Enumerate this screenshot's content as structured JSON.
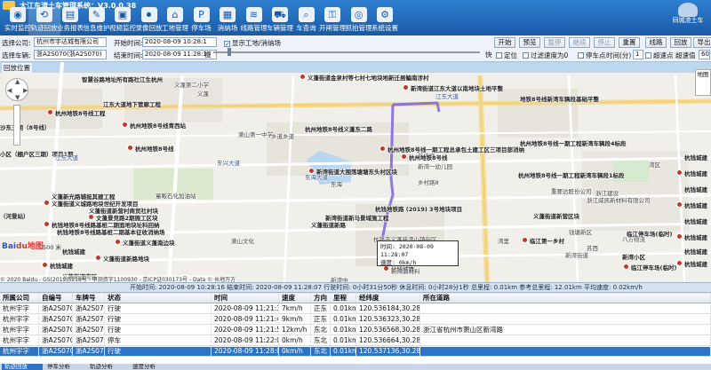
{
  "app": {
    "title": "大江东渣土车管理系统：V3.0.0.38"
  },
  "toolbar": {
    "items": [
      {
        "label": "实时监控",
        "icon": "monitor-icon"
      },
      {
        "label": "轨迹回放",
        "icon": "track-playback-icon"
      },
      {
        "label": "业务报表",
        "icon": "report-icon"
      },
      {
        "label": "信息维护",
        "icon": "info-maintenance-icon"
      },
      {
        "label": "视频监控",
        "icon": "video-icon"
      },
      {
        "label": "录像回放",
        "icon": "recording-icon"
      },
      {
        "label": "工地管理",
        "icon": "site-icon"
      },
      {
        "label": "停车场",
        "icon": "parking-icon"
      },
      {
        "label": "消纳场",
        "icon": "disposal-icon"
      },
      {
        "label": "线路管理",
        "icon": "route-icon"
      },
      {
        "label": "车辆管理",
        "icon": "vehicle-icon"
      },
      {
        "label": "车查询",
        "icon": "vehicle-query-icon"
      },
      {
        "label": "开闸管理",
        "icon": "gate-icon"
      },
      {
        "label": "抓拍管理",
        "icon": "snapshot-icon"
      },
      {
        "label": "系统设置",
        "icon": "settings-icon"
      }
    ],
    "corner_logo": "同城渣土车"
  },
  "controls": {
    "company_label": "选择公司:",
    "company_value": "杭州市宇达城有限公司",
    "vehicle_label": "选择车辆:",
    "vehicle_value": "浙A2S070(浙A2S070)",
    "start_label": "开始时间:",
    "start_value": "2020-08-09 10:28:1",
    "end_label": "结束时间:",
    "end_value": "2020-08-09 11:28:1",
    "show_sites": "显示工地/消纳场",
    "slow_label": "慢",
    "fast_label": "快",
    "locate_label": "定位",
    "parking_label": "停车点",
    "filter_speed_label": "过滤速度为0",
    "stop_time_label": "停车点",
    "time_unit_label": "时间(分)",
    "stop_time_value": "1",
    "overspeed_label": "超速点",
    "overspeed_limit_label": "超速值",
    "overspeed_value": "60",
    "track_return_label": "回放位置",
    "buttons": [
      "开始",
      "预览",
      "暂停",
      "继续",
      "停止",
      "重置",
      "线路",
      "回放",
      "导出"
    ]
  },
  "map": {
    "pois": [
      {
        "t": "义蓬街道金泉村等七村七地块地新迁居鳊南涉村",
        "s": "poi"
      },
      {
        "t": "智慧谷路地址所有路社江生杭州",
        "s": "poi"
      },
      {
        "t": "新湾街道江东大道以南地块土地平整",
        "s": "poi"
      },
      {
        "t": "江东大道地下管廊工程",
        "s": "poi"
      },
      {
        "t": "杭州地铁8号线工程",
        "s": "poi"
      },
      {
        "t": "地铁8号线新湾车辆段基础平整",
        "s": "poi"
      },
      {
        "t": "杭州地铁8号线青西站",
        "s": "poi"
      },
      {
        "t": "杭州地铁8号线义蓬东二路",
        "s": "poi"
      },
      {
        "t": "江东大道",
        "s": "blue"
      },
      {
        "t": "义蓬第二小学",
        "s": "plain"
      },
      {
        "t": "杭州地铁8号线一期工程总承包土建工区三项目部消纳",
        "s": "poi"
      },
      {
        "t": "杭州地铁8号线一期工程新湾车辆段4标段",
        "s": "poi"
      },
      {
        "t": "新湾街道大围荡塘塘东头村区块",
        "s": "poi"
      },
      {
        "t": "杭州地铁8号线一期工程新湾车辆段1标段",
        "s": "poi"
      },
      {
        "t": "重要达股份公司",
        "s": "plain"
      },
      {
        "t": "杭钱城建",
        "s": "poi"
      },
      {
        "t": "杭钱城建",
        "s": "poi"
      },
      {
        "t": "东海大道",
        "s": "blue"
      },
      {
        "t": "童畈石化加油站",
        "s": "plain"
      },
      {
        "t": "义蓬新光路辅挺其建工程",
        "s": "poi"
      },
      {
        "t": "义蓬街道义城路地块世纪开发项目",
        "s": "poi"
      },
      {
        "t": "杭钱城建",
        "s": "poi"
      },
      {
        "t": "杭钱城建",
        "s": "poi"
      },
      {
        "t": "义蓬街道新营村商贸社村块",
        "s": "poi"
      },
      {
        "t": "文蓬景竞路2期施工区块",
        "s": "poi"
      },
      {
        "t": "杭钱城建",
        "s": "poi"
      },
      {
        "t": "杭钱地铁8号线路基桩二期面地块址科回纳",
        "s": "poi"
      },
      {
        "t": "杭钱地铁8号线路基桩二期基本征收消纳场",
        "s": "poi"
      },
      {
        "t": "义蓬街道义蓬南边块",
        "s": "poi"
      },
      {
        "t": "新湾街道新马景域施工程",
        "s": "poi"
      },
      {
        "t": "杭钱城建",
        "s": "poi"
      },
      {
        "t": "杭钱城建",
        "s": "poi"
      },
      {
        "t": "杭钱城建",
        "s": "poi"
      },
      {
        "t": "义蓬街道新路",
        "s": "poi"
      },
      {
        "t": "义蓬街道新路地块",
        "s": "poi"
      },
      {
        "t": "杭钱城建",
        "s": "poi"
      },
      {
        "t": "杭钱城建",
        "s": "poi"
      },
      {
        "t": "杭钱城建",
        "s": "poi"
      },
      {
        "t": "杭钱城建",
        "s": "poi"
      },
      {
        "t": "义蓬街道新营区块",
        "s": "poi"
      },
      {
        "t": "临江第一乡村",
        "s": "poi"
      },
      {
        "t": "义蓬街道南区",
        "s": "poi"
      },
      {
        "t": "杭钱城建",
        "s": "poi"
      },
      {
        "t": "新湾小区",
        "s": "poi"
      },
      {
        "t": "临江停车场(临时)",
        "s": "poi"
      },
      {
        "t": "乡道乡道",
        "s": "plain"
      },
      {
        "t": "新湾一幼儿园",
        "s": "plain"
      },
      {
        "t": "新湾路",
        "s": "plain"
      },
      {
        "t": "浙江威凯新材料有限公司",
        "s": "plain"
      },
      {
        "t": "浙江建设",
        "s": "plain"
      },
      {
        "t": "八方物流",
        "s": "plain"
      },
      {
        "t": "苏西",
        "s": "plain"
      },
      {
        "t": "新湾街道",
        "s": "plain"
      },
      {
        "t": "钱塘新区",
        "s": "plain"
      },
      {
        "t": "新湾鼎材料",
        "s": "plain"
      },
      {
        "t": "东兴大道",
        "s": "blue"
      },
      {
        "t": "新湾中",
        "s": "plain"
      },
      {
        "t": "湾区",
        "s": "plain"
      },
      {
        "t": "东海",
        "s": "plain"
      },
      {
        "t": "萧山文化",
        "s": "plain"
      },
      {
        "t": "义蓬",
        "s": "plain"
      },
      {
        "t": "沙东三期（8号线）",
        "s": "poi"
      },
      {
        "t": "小区（棚户区三期）项目1期",
        "s": "poi"
      },
      {
        "t": "（河景站）",
        "s": "poi"
      },
      {
        "t": "萧山第一中学",
        "s": "plain"
      },
      {
        "t": "乡村路8",
        "s": "plain"
      },
      {
        "t": "杭州地铁8号线",
        "s": "poi"
      },
      {
        "t": "江东大道",
        "s": "blue"
      },
      {
        "t": "杭州地铁8号线",
        "s": "poi"
      },
      {
        "t": "杭钱地铁路 (2019) 3号地块项目",
        "s": "poi"
      },
      {
        "t": "杭钱市义蓬新湾小镇街区",
        "s": "plain"
      },
      {
        "t": "湾里",
        "s": "plain"
      },
      {
        "t": "新湾街道",
        "s": "plain"
      },
      {
        "t": "临江停车场(临时)",
        "s": "poi"
      }
    ],
    "tooltip_time": "时间: 2020-08-09 11:28:07",
    "tooltip_speed": "速度: 0km/h",
    "baidu_label_1": "Bai",
    "baidu_label_2": "du地图",
    "scale_label": "500 米",
    "copyright": "© 2020 Baidu - GS(2019)5218号 - 甲测资字1100930 - 京ICP证030173号 - Data © 长地万方",
    "maptype_label": "地图"
  },
  "summary": "开始时间: 2020-08-09 10:28:16  结束时间: 2020-08-09 11:28:07  行驶时间: 0小时31分50秒  休息时间: 0小时28分1秒  总里程: 0.01km  参考总里程: 12.01km  平均速度: 0.02km/h",
  "table": {
    "columns": [
      "所属公司",
      "自编号",
      "车牌号",
      "状态",
      "时间",
      "速度",
      "方向",
      "里程",
      "经纬度",
      "所在道路"
    ],
    "rows": [
      [
        "杭州宇字",
        "浙A2S070",
        "浙A2S07",
        "行驶",
        "2020-08-09 11:21:37",
        "7km/h",
        "正东",
        "0.01km",
        "120.536184,30.288",
        ""
      ],
      [
        "杭州宇字",
        "浙A2S070",
        "浙A2S07",
        "行驶",
        "2020-08-09 11:21:47",
        "9km/h",
        "正东",
        "0.01km",
        "120.536323,30.288",
        ""
      ],
      [
        "杭州宇字",
        "浙A2S070",
        "浙A2S07",
        "行驶",
        "2020-08-09 11:21:57",
        "12km/h",
        "东北",
        "0.01km",
        "120.536568,30.288",
        "浙江省杭州市萧山区新湾路"
      ],
      [
        "杭州宇字",
        "浙A2S070",
        "浙A2S07",
        "停车",
        "2020-08-09 11:22:07",
        "0km/h",
        "东北",
        "0.01km",
        "120.536664,30.288",
        ""
      ],
      [
        "杭州宇字",
        "浙A2S070",
        "浙A2S07",
        "行驶",
        "2020-08-09 11:28:07",
        "0km/h",
        "东北",
        "0.01km",
        "120.537136,30.288",
        ""
      ]
    ]
  },
  "tabs": [
    "轨迹回放",
    "停车分析",
    "轨迹分析",
    "速度分析"
  ]
}
